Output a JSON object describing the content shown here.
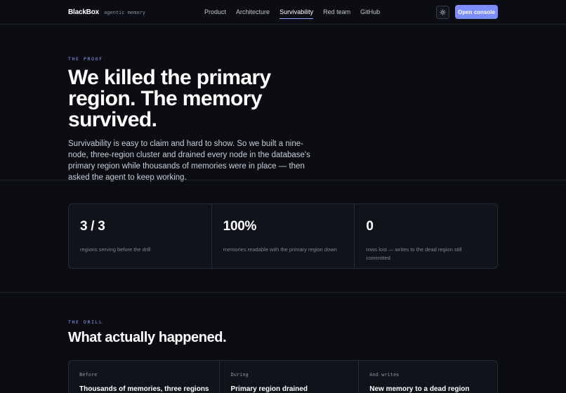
{
  "nav": {
    "brand": "BlackBox",
    "tagline": "agentic memory",
    "links": [
      "Product",
      "Architecture",
      "Survivability",
      "Red team",
      "GitHub"
    ],
    "active_link": "Survivability",
    "theme_icon": "sun-icon",
    "cta": "Open console"
  },
  "hero": {
    "eyebrow": "THE PROOF",
    "title": "We killed the primary region. The memory survived.",
    "lede": "Survivability is easy to claim and hard to show. So we built a nine-node, three-region cluster and drained every node in the database's primary region while thousands of memories were in place — then asked the agent to keep working."
  },
  "stats": [
    {
      "value": "3 / 3",
      "label": "regions serving before the drill"
    },
    {
      "value": "100%",
      "label": "memories readable with the primary region down"
    },
    {
      "value": "0",
      "label": "rows lost — writes to the dead region still committed"
    }
  ],
  "drill": {
    "eyebrow": "THE DRILL",
    "title": "What actually happened.",
    "steps": [
      {
        "tag": "Before",
        "title": "Thousands of memories, three regions"
      },
      {
        "tag": "During",
        "title": "Primary region drained"
      },
      {
        "tag": "And writes",
        "title": "New memory to a dead region"
      }
    ]
  },
  "colors": {
    "background": "#0b0d12",
    "accent": "#7c8cf8",
    "eyebrow": "#8ea2ff"
  }
}
